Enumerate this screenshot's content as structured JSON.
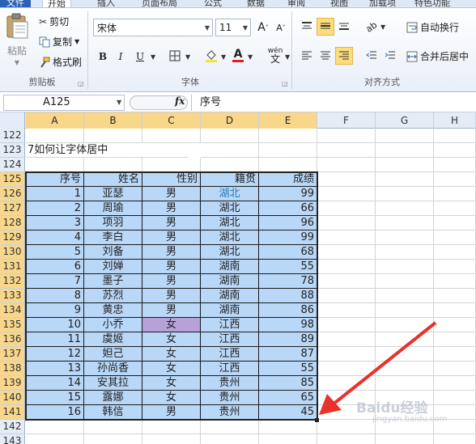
{
  "tabs": [
    "文件",
    "开始",
    "插入",
    "页面布局",
    "公式",
    "数据",
    "审阅",
    "视图",
    "加载项",
    "特色功能"
  ],
  "clipboard": {
    "paste_label": "粘贴",
    "cut_label": "剪切",
    "copy_label": "复制",
    "format_painter_label": "格式刷",
    "group_label": "剪贴板"
  },
  "font": {
    "font_name": "宋体",
    "font_size": "11",
    "bold": "B",
    "italic": "I",
    "underline": "U",
    "grow": "A",
    "shrink": "A",
    "font_color_letter": "A",
    "phonetic": "wén",
    "group_label": "字体",
    "fill_color": "#f4e33a",
    "text_color": "#e02020"
  },
  "alignment": {
    "wrap_label": "自动换行",
    "merge_label": "合并后居中",
    "group_label": "对齐方式"
  },
  "formula_bar": {
    "name_box": "A125",
    "fx": "fx",
    "content": "序号"
  },
  "columns": [
    "A",
    "B",
    "C",
    "D",
    "E",
    "F",
    "G",
    "H"
  ],
  "title_row": {
    "row": "123",
    "text": "7如何让字体居中"
  },
  "header": [
    "序号",
    "姓名",
    "性别",
    "籍贯",
    "成绩"
  ],
  "rows": [
    {
      "row": "126",
      "cells": [
        "1",
        "亚瑟",
        "男",
        "湖北",
        "99"
      ]
    },
    {
      "row": "127",
      "cells": [
        "2",
        "周瑜",
        "男",
        "湖北",
        "66"
      ]
    },
    {
      "row": "128",
      "cells": [
        "3",
        "项羽",
        "男",
        "湖北",
        "96"
      ]
    },
    {
      "row": "129",
      "cells": [
        "4",
        "李白",
        "男",
        "湖北",
        "99"
      ]
    },
    {
      "row": "130",
      "cells": [
        "5",
        "刘备",
        "男",
        "湖北",
        "68"
      ]
    },
    {
      "row": "131",
      "cells": [
        "6",
        "刘婵",
        "男",
        "湖南",
        "55"
      ]
    },
    {
      "row": "132",
      "cells": [
        "7",
        "墨子",
        "男",
        "湖南",
        "78"
      ]
    },
    {
      "row": "133",
      "cells": [
        "8",
        "苏烈",
        "男",
        "湖南",
        "88"
      ]
    },
    {
      "row": "134",
      "cells": [
        "9",
        "黄忠",
        "男",
        "湖南",
        "86"
      ]
    },
    {
      "row": "135",
      "cells": [
        "10",
        "小乔",
        "女",
        "江西",
        "98"
      ]
    },
    {
      "row": "136",
      "cells": [
        "11",
        "虞姬",
        "女",
        "江西",
        "89"
      ]
    },
    {
      "row": "137",
      "cells": [
        "12",
        "妲己",
        "女",
        "江西",
        "87"
      ]
    },
    {
      "row": "138",
      "cells": [
        "13",
        "孙尚香",
        "女",
        "江西",
        "55"
      ]
    },
    {
      "row": "139",
      "cells": [
        "14",
        "安其拉",
        "女",
        "贵州",
        "85"
      ]
    },
    {
      "row": "140",
      "cells": [
        "15",
        "露娜",
        "女",
        "贵州",
        "65"
      ]
    },
    {
      "row": "141",
      "cells": [
        "16",
        "韩信",
        "男",
        "贵州",
        "45"
      ]
    }
  ],
  "extra_rows": [
    "122",
    "124",
    "142",
    "143"
  ],
  "header_row_num": "125",
  "colors": {
    "data_fill": "#b9d7f7",
    "highlight_fill": "#b6a2d9",
    "arrow": "#e8322b",
    "selected_header": "#f8d78a"
  },
  "watermark": {
    "brand": "Baidu经验",
    "sub": "jingyan.baidu.com"
  }
}
